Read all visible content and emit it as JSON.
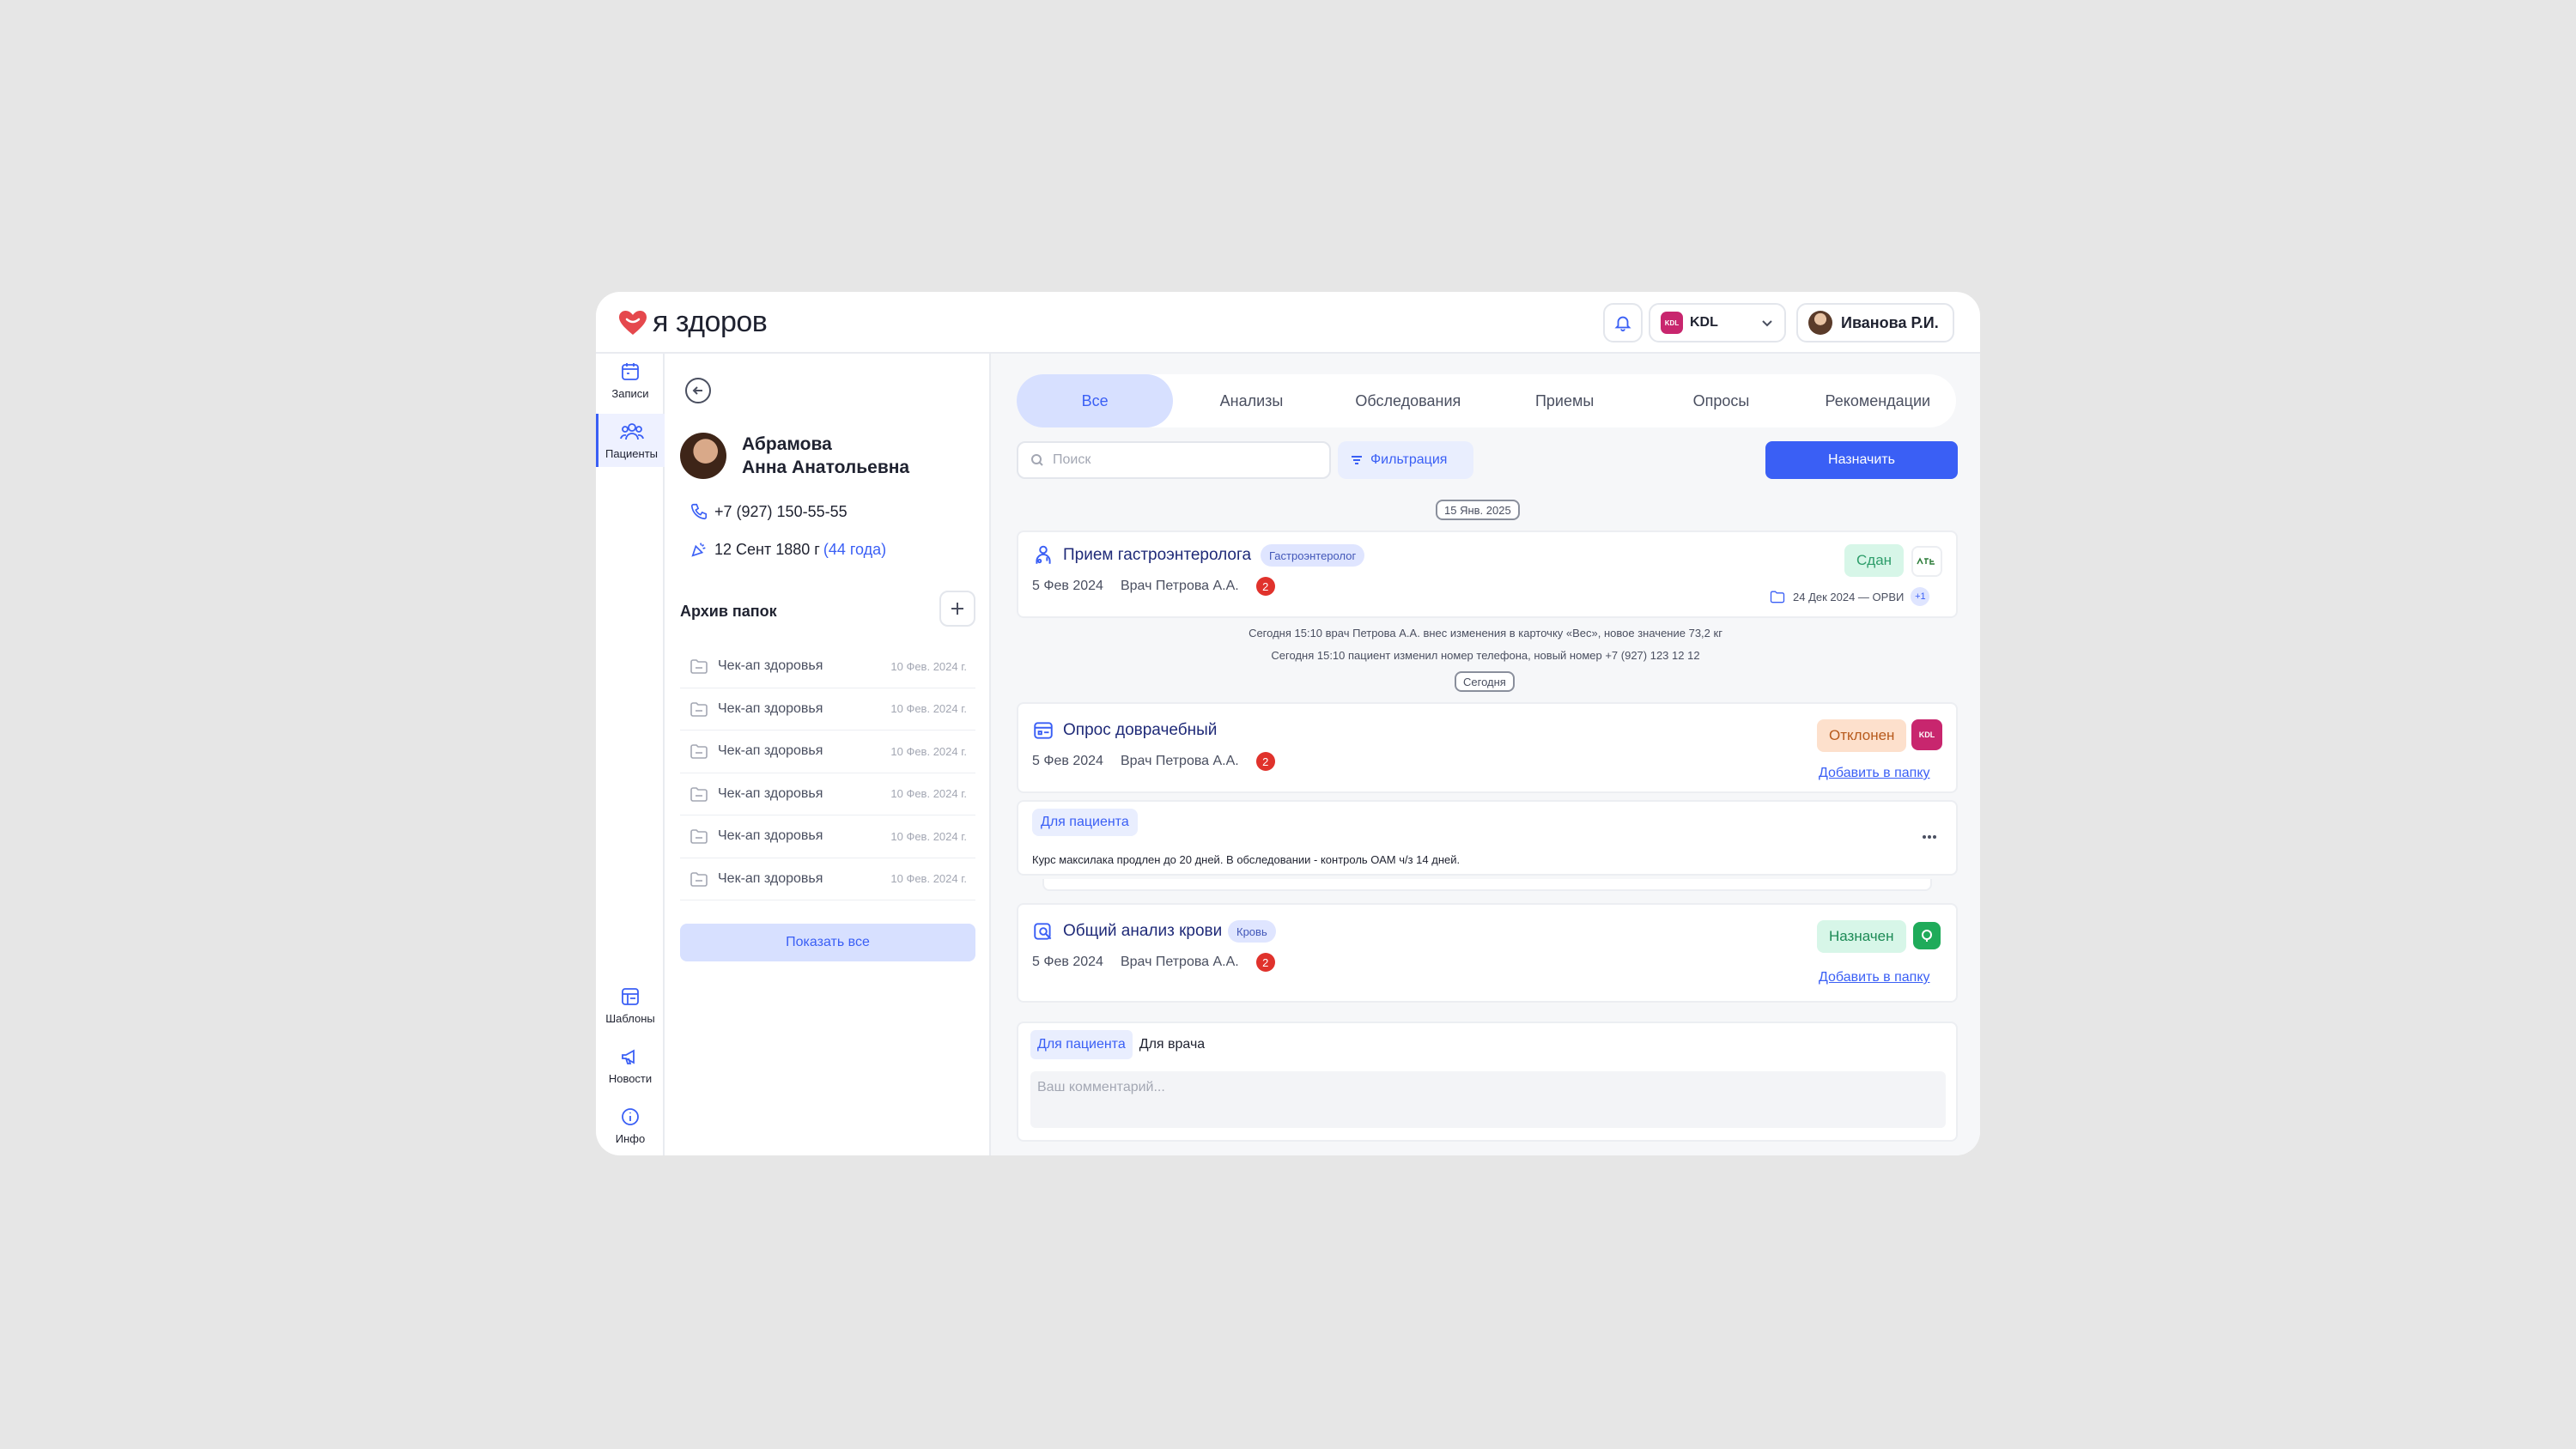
{
  "header": {
    "logo_text": "я здоров",
    "lab": "KDL",
    "lab_logo_text": "KDL",
    "user_name": "Иванова Р.И."
  },
  "nav": {
    "records": "Записи",
    "patients": "Пациенты",
    "templates": "Шаблоны",
    "news": "Новости",
    "info": "Инфо"
  },
  "patient": {
    "last_name": "Абрамова",
    "first_middle": "Анна Анатольевна",
    "phone": "+7 (927) 150-55-55",
    "birth_date": "12 Сент 1880 г",
    "age": "(44 года)",
    "archive_title": "Архив папок",
    "folders": [
      {
        "name": "Чек-ап здоровья",
        "date": "10 Фев. 2024 г."
      },
      {
        "name": "Чек-ап здоровья",
        "date": "10 Фев. 2024 г."
      },
      {
        "name": "Чек-ап здоровья",
        "date": "10 Фев. 2024 г."
      },
      {
        "name": "Чек-ап здоровья",
        "date": "10 Фев. 2024 г."
      },
      {
        "name": "Чек-ап здоровья",
        "date": "10 Фев. 2024 г."
      },
      {
        "name": "Чек-ап здоровья",
        "date": "10 Фев. 2024 г."
      }
    ],
    "show_all": "Показать все"
  },
  "tabs": [
    "Все",
    "Анализы",
    "Обследования",
    "Приемы",
    "Опросы",
    "Рекомендации"
  ],
  "toolbar": {
    "search_placeholder": "Поиск",
    "filter": "Фильтрация",
    "assign": "Назначить"
  },
  "feed": {
    "date1": "15 Янв. 2025",
    "card1": {
      "title": "Прием гастроэнтеролога",
      "tag": "Гастроэнтеролог",
      "date": "5 Фев 2024",
      "doctor": "Врач Петрова А.А.",
      "count": "2",
      "status": "Сдан",
      "related": "24 Дек 2024 — ОРВИ",
      "related_more": "+1"
    },
    "note1": "Сегодня 15:10 врач Петрова А.А. внес изменения в карточку «Вес», новое значение 73,2 кг",
    "note2": "Сегодня 15:10 пациент изменил номер телефона, новый номер +7 (927) 123 12 12",
    "date2": "Сегодня",
    "card2": {
      "title": "Опрос доврачебный",
      "date": "5 Фев 2024",
      "doctor": "Врач Петрова А.А.",
      "count": "2",
      "status": "Отклонен",
      "lab_logo_text": "KDL",
      "add_folder": "Добавить в папку"
    },
    "card3": {
      "tag": "Для пациента",
      "text": "Курс максилака продлен до 20 дней. В обследовании - контроль ОАМ ч/з 14 дней."
    },
    "card4": {
      "title": "Общий анализ крови",
      "tag": "Кровь",
      "date": "5 Фев 2024",
      "doctor": "Врач Петрова А.А.",
      "count": "2",
      "status": "Назначен",
      "add_folder": "Добавить в папку"
    },
    "comment": {
      "tab_patient": "Для пациента",
      "tab_doctor": "Для врача",
      "placeholder": "Ваш  комментарий..."
    }
  },
  "colors": {
    "accent": "#3a5ff5",
    "brand_heart": "#e5484d",
    "kdl": "#c8266e",
    "status_done": "#d7f6e8",
    "status_rejected": "#fde0cc",
    "count_badge": "#e0322c"
  },
  "icons": [
    "heart-logo-icon",
    "bell-icon",
    "chevron-down-icon",
    "calendar-icon",
    "patients-icon",
    "templates-icon",
    "megaphone-icon",
    "info-icon",
    "back-arrow-icon",
    "phone-icon",
    "birthday-icon",
    "plus-icon",
    "folder-icon",
    "search-icon",
    "filter-icon",
    "doctor-icon",
    "survey-icon",
    "analysis-icon",
    "more-icon"
  ]
}
